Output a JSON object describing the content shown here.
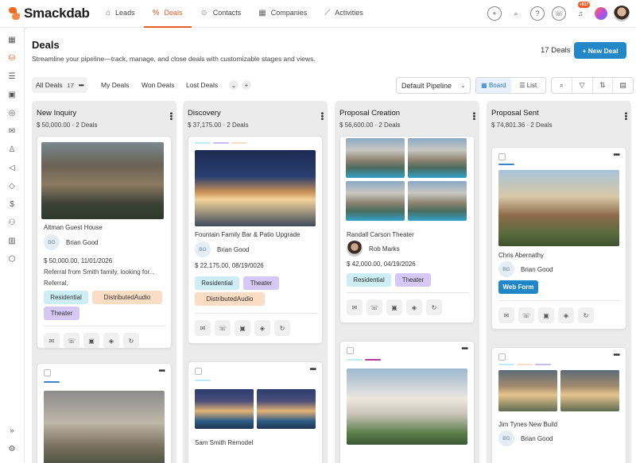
{
  "app": {
    "name": "Smackdab"
  },
  "nav": [
    {
      "label": "Leads",
      "icon": "leads-icon",
      "glyph": "⌂"
    },
    {
      "label": "Deals",
      "icon": "deals-icon",
      "glyph": "%"
    },
    {
      "label": "Contacts",
      "icon": "contacts-icon",
      "glyph": "☺"
    },
    {
      "label": "Companies",
      "icon": "companies-icon",
      "glyph": "▦"
    },
    {
      "label": "Activities",
      "icon": "activities-icon",
      "glyph": "⟋"
    }
  ],
  "top_actions": {
    "notification_count": "+817"
  },
  "page": {
    "title": "Deals",
    "subtitle": "Streamline your pipeline—track, manage, and close deals with customizable stages and views.",
    "deal_count": "17 Deals",
    "new_deal_label": "+ New Deal"
  },
  "tabs": [
    {
      "label": "All Deals",
      "count": "17"
    },
    {
      "label": "My Deals"
    },
    {
      "label": "Won Deals"
    },
    {
      "label": "Lost Deals"
    }
  ],
  "pipeline": {
    "selected": "Default Pipeline"
  },
  "view": {
    "board_label": "Board",
    "list_label": "List"
  },
  "columns": [
    {
      "title": "New Inquiry",
      "summary": "$ 50,000.00 · 2 Deals",
      "cards": [
        {
          "name": "Altman Guest House",
          "person": "Brian Good",
          "initials": "BG",
          "amount_date": "$ 50,000.00, 11/01/2026",
          "note": "Referral from Smith family, looking for...",
          "note2": "Referral,",
          "tags": [
            "Residential",
            "DistributedAudio",
            "Theater"
          ]
        }
      ]
    },
    {
      "title": "Discovery",
      "summary": "$ 37,175.00 · 2 Deals",
      "cards": [
        {
          "name": "Fountain Family Bar & Patio Upgrade",
          "person": "Brian Good",
          "initials": "BG",
          "amount_date": "$ 22,175.00, 08/19/0026",
          "tags": [
            "Residential",
            "Theater",
            "DistributedAudio"
          ]
        },
        {
          "name": "Sam Smith Remodel"
        }
      ]
    },
    {
      "title": "Proposal Creation",
      "summary": "$ 56,600.00 · 2 Deals",
      "cards": [
        {
          "name": "Randall Carson Theater",
          "person": "Rob Marks",
          "amount_date": "$ 42,000.00, 04/19/2026",
          "tags": [
            "Residential",
            "Theater"
          ]
        }
      ]
    },
    {
      "title": "Proposal Sent",
      "summary": "$ 74,801.36 · 2 Deals",
      "cards": [
        {
          "name": "Chris Abernathy",
          "person": "Brian Good",
          "initials": "BG",
          "tags": [
            "Web Form"
          ]
        },
        {
          "name": "Jim Tynes New Build",
          "person": "Brian Good",
          "initials": "BG"
        }
      ]
    }
  ],
  "colors": {
    "accent": "#e85d2a",
    "primary": "#2388c8"
  }
}
